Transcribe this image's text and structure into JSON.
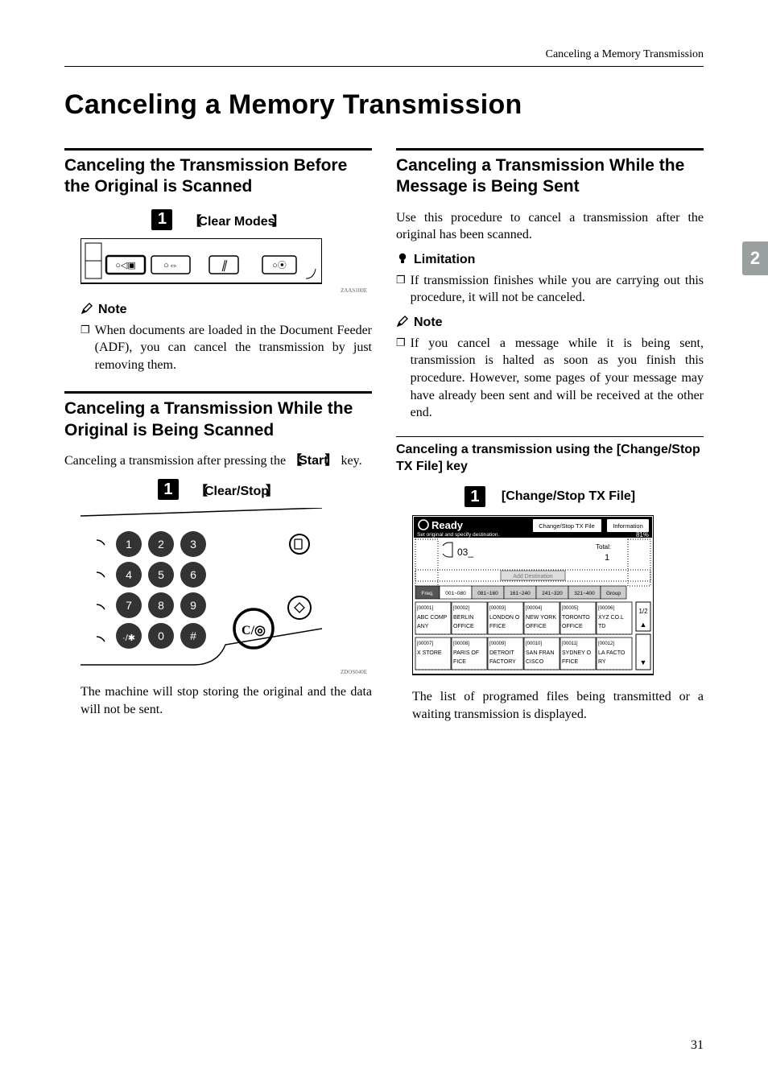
{
  "running_head": "Canceling a Memory Transmission",
  "title": "Canceling a Memory Transmission",
  "side_tab": "2",
  "page_number": "31",
  "left": {
    "sec1": {
      "heading": "Canceling the Transmission Before the Original is Scanned",
      "step1_label": "Clear Modes",
      "panel_code": "ZAAS100E",
      "note_label": "Note",
      "note_item": "When documents are loaded in the Document Feeder (ADF), you can cancel the transmission by just removing them."
    },
    "sec2": {
      "heading": "Canceling a Transmission While the Original is Being Scanned",
      "intro_prefix": "Canceling a transmission after pressing the ",
      "intro_key": "Start",
      "intro_suffix": " key.",
      "step1_label": "Clear/Stop",
      "keypad_code": "ZDOS040E",
      "outro": "The machine will stop storing the original and the data will not be sent."
    }
  },
  "right": {
    "sec1": {
      "heading": "Canceling a Transmission While the Message is Being Sent",
      "intro": "Use this procedure to cancel a transmission after the original has been scanned.",
      "limitation_label": "Limitation",
      "limitation_item": "If transmission finishes while you are carrying out this procedure, it will not be canceled.",
      "note_label": "Note",
      "note_item": "If you cancel a message while it is being sent, transmission is halted as soon as you finish this procedure. However, some pages of your message may have already been sent and will be received at the other end."
    },
    "sub": {
      "heading": "Canceling a transmission using the [Change/Stop TX File] key",
      "step1_label": "[Change/Stop TX File]",
      "display": {
        "ready": "Ready",
        "instruct": "Set original and specify destination.",
        "btn_change": "Change/Stop TX File",
        "btn_info": "Information",
        "mem": "81%",
        "input": "03_",
        "total_label": "Total:",
        "total_value": "1",
        "add_dest": "Add Destination",
        "ranges_head": "Freq.",
        "ranges": [
          "001~080",
          "081~160",
          "161~240",
          "241~320",
          "321~400",
          "Group"
        ],
        "row1": [
          {
            "id": "[00001]",
            "l1": "ABC COMP",
            "l2": "ANY"
          },
          {
            "id": "[00002]",
            "l1": "BERLIN",
            "l2": "OFFICE"
          },
          {
            "id": "[00003]",
            "l1": "LONDON O",
            "l2": "FFICE"
          },
          {
            "id": "[00004]",
            "l1": "NEW YORK",
            "l2": " OFFICE"
          },
          {
            "id": "[00005]",
            "l1": "TORONTO",
            "l2": "OFFICE"
          },
          {
            "id": "[00006]",
            "l1": "XYZ CO.L",
            "l2": "TD"
          }
        ],
        "row2": [
          {
            "id": "[00007]",
            "l1": "X STORE",
            "l2": ""
          },
          {
            "id": "[00008]",
            "l1": "PARIS OF",
            "l2": "FICE"
          },
          {
            "id": "[00009]",
            "l1": "DETROIT",
            "l2": "FACTORY"
          },
          {
            "id": "[00010]",
            "l1": "SAN FRAN",
            "l2": "CISCO"
          },
          {
            "id": "[00011]",
            "l1": "SYDNEY O",
            "l2": "FFICE"
          },
          {
            "id": "[00012]",
            "l1": "LA FACTO",
            "l2": "RY"
          }
        ],
        "page_ind": "1/2"
      },
      "outro": "The list of programed files being transmitted or a waiting transmission is displayed."
    }
  }
}
